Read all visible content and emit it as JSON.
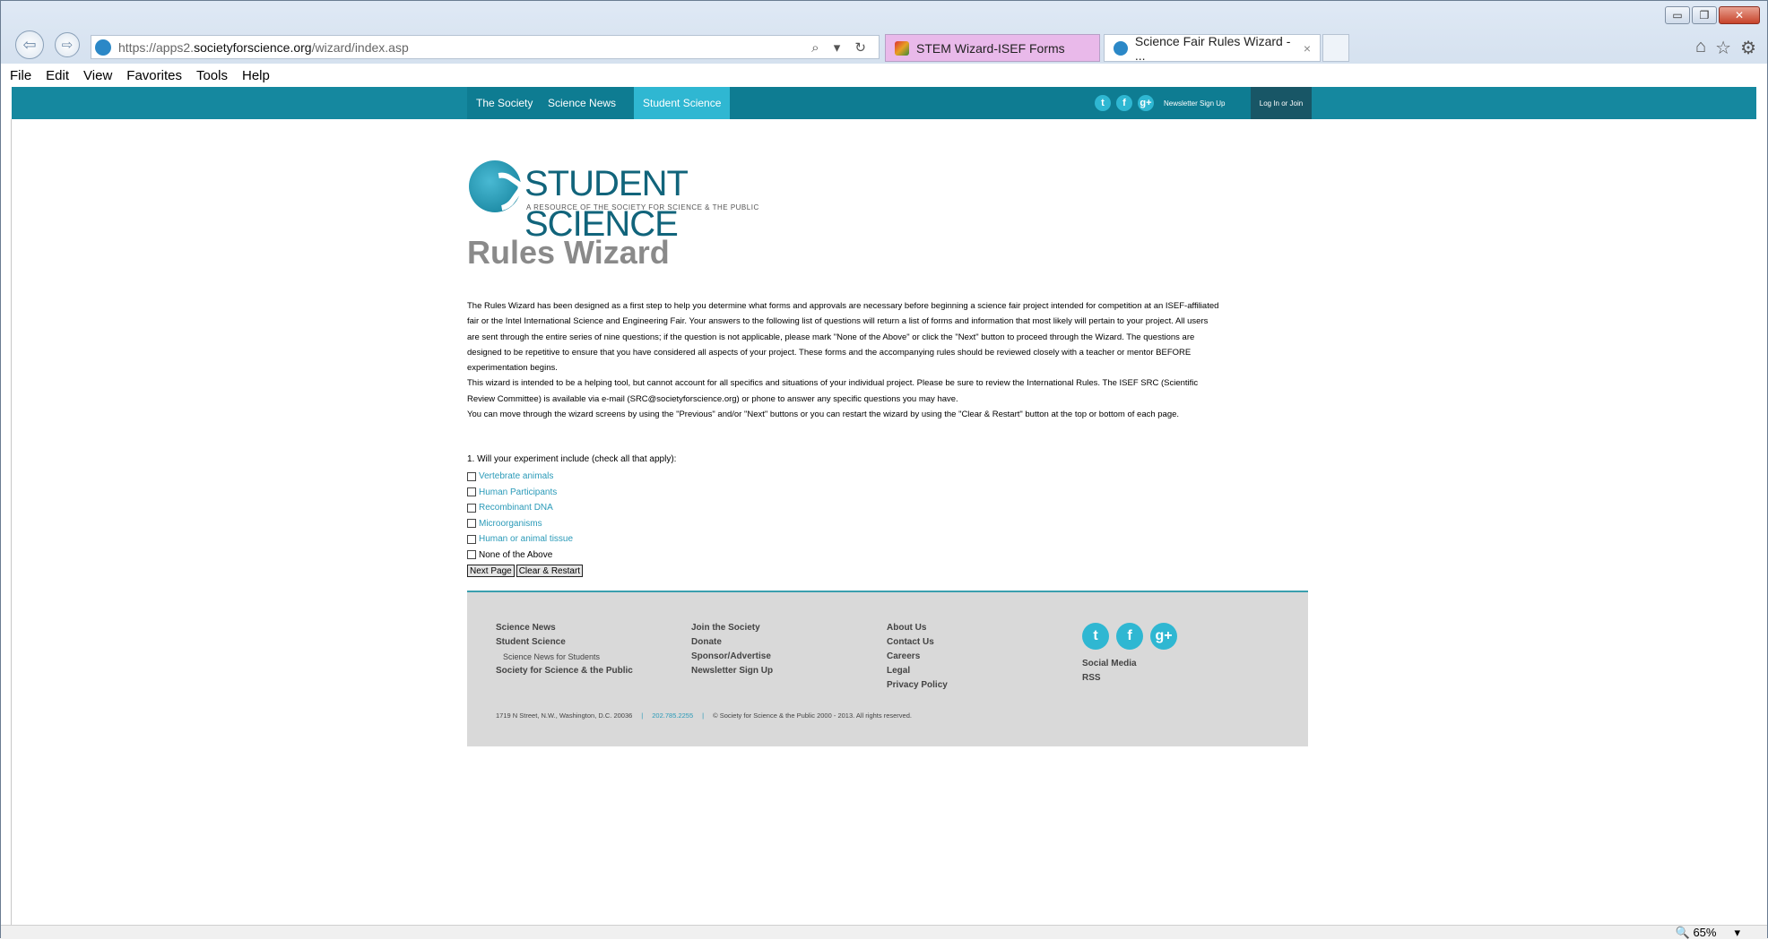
{
  "browser": {
    "url_prefix": "https://apps2.",
    "url_domain": "societyforscience.org",
    "url_path": "/wizard/index.asp",
    "address_tools": "⌕ ▾ ↻",
    "tabs": [
      {
        "label": "STEM Wizard-ISEF Forms"
      },
      {
        "label": "Science Fair Rules Wizard - ...",
        "close": "×"
      }
    ],
    "window_controls": {
      "minimize": "▭",
      "restore": "❐",
      "close": "✕"
    },
    "nav_back": "⇦",
    "nav_forward": "⇨",
    "icons": {
      "home": "⌂",
      "favorites": "☆",
      "settings": "⚙"
    },
    "menu": [
      "File",
      "Edit",
      "View",
      "Favorites",
      "Tools",
      "Help"
    ],
    "zoom": "65%",
    "zoom_icon": "🔍",
    "zoom_arrow": "▾"
  },
  "site_nav": {
    "items": [
      "The Society",
      "Science News",
      "Student Science"
    ],
    "active": "Student Science",
    "social": [
      "t",
      "f",
      "g+"
    ],
    "newsletter": "Newsletter Sign Up",
    "login": "Log In or Join"
  },
  "logo": {
    "name": "STUDENT SCIENCE",
    "tagline": "A RESOURCE OF THE SOCIETY FOR SCIENCE & THE PUBLIC"
  },
  "page_title": "Rules Wizard",
  "intro": {
    "p1": "The Rules Wizard has been designed as a first step to help you determine what forms and approvals are necessary before beginning a science fair project intended for competition at an ISEF-affiliated fair or the Intel International Science and Engineering Fair.  Your answers to the following list of questions will return a list of forms and information that most likely will pertain to your project.  All users are sent through the entire series of nine questions; if the question is not applicable, please mark \"None of the Above\" or click the \"Next\" button to proceed through the Wizard.  The questions are designed to be repetitive to ensure that you have considered all aspects of your project.  These forms and the accompanying rules should be reviewed closely with a teacher or mentor BEFORE experimentation begins.",
    "p2": "This wizard is intended to be a helping tool, but cannot account for all specifics and situations of your individual project.  Please be sure to review the International Rules.  The ISEF SRC (Scientific Review Committee) is available via e-mail (SRC@societyforscience.org) or phone to answer any specific questions you may have.",
    "p3": "You can move through the wizard screens by using the \"Previous\" and/or \"Next\" buttons or you can restart the wizard by using the \"Clear & Restart\" button at the top or bottom of each page."
  },
  "question": {
    "text": "1. Will your experiment include (check all that apply):",
    "options": [
      {
        "label": "Vertebrate animals",
        "link": true
      },
      {
        "label": "Human Participants",
        "link": true
      },
      {
        "label": "Recombinant DNA",
        "link": true
      },
      {
        "label": "Microorganisms",
        "link": true
      },
      {
        "label": "Human or animal tissue",
        "link": true
      },
      {
        "label": "None of the Above",
        "link": false
      }
    ]
  },
  "buttons": {
    "next": "Next Page",
    "clear": "Clear & Restart"
  },
  "footer": {
    "col1": [
      "Science News",
      "Student Science",
      "Science News for Students",
      "Society for Science & the Public"
    ],
    "col2": [
      "Join the Society",
      "Donate",
      "Sponsor/Advertise",
      "Newsletter Sign Up"
    ],
    "col3": [
      "About Us",
      "Contact Us",
      "Careers",
      "Legal",
      "Privacy Policy"
    ],
    "social": [
      "t",
      "f",
      "g+"
    ],
    "col4": [
      "Social Media",
      "RSS"
    ],
    "address": "1719 N Street, N.W., Washington, D.C. 20036",
    "phone": "202.785.2255",
    "separator": "|",
    "copyright": "© Society for Science & the Public 2000 - 2013. All rights reserved."
  }
}
